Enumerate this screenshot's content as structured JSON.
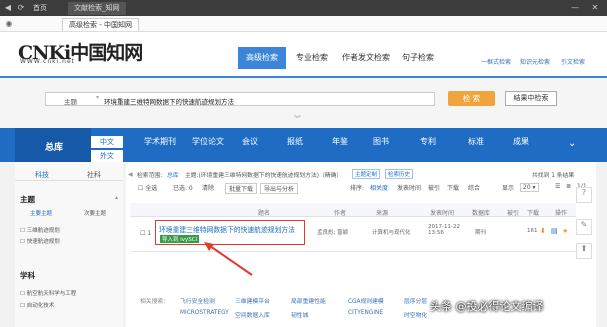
{
  "browser": {
    "tabs": [
      "首页",
      "文献检索_知网"
    ],
    "address_tab": "高级检索 - 中国知网"
  },
  "logo": {
    "text": "CNKi中国知网",
    "url": "WWW.cnki.net"
  },
  "nav": {
    "tabs": [
      "高级检索",
      "专业检索",
      "作者发文检索",
      "句子检索"
    ],
    "links": [
      "一框式检索",
      "知识元检索",
      "引文检索"
    ]
  },
  "search": {
    "field": "主题",
    "query": "环境重建三维特网数据下的快速航迹规划方法",
    "search_label": "检 索",
    "in_results_label": "结果中检索"
  },
  "db": {
    "total_label": "总库",
    "lang": [
      "中文",
      "外文"
    ],
    "categories": [
      "学术期刊",
      "学位论文",
      "会议",
      "报纸",
      "年鉴",
      "图书",
      "专利",
      "标准",
      "成果"
    ]
  },
  "left": {
    "sci_tabs": [
      "科技",
      "社科"
    ],
    "topic_title": "主题",
    "topic_tabs": [
      "主要主题",
      "次要主题"
    ],
    "topics": [
      "三维航迹规划",
      "快速航迹规划"
    ],
    "subject_title": "学科",
    "subjects": [
      "航空航天科学与工程",
      "自动化技术"
    ]
  },
  "toolbar": {
    "scope_label": "检索范围:",
    "scope_value": "总库",
    "query_echo": "主题:(环境重建三维特网数据下的快速航迹规划方法)（精确）",
    "theme_label": "主题定制",
    "history_label": "检索历史",
    "result_count": "共找到 1 条结果",
    "all_label": "全选",
    "selected": "已选: 0",
    "clear": "清除",
    "batch": "批量下载",
    "export": "导出与分析",
    "sort_label": "排序:",
    "sort_opts": [
      "相关度",
      "发表时间",
      "被引",
      "下载",
      "综合"
    ],
    "page_size": "显示",
    "pager": "1/1"
  },
  "table": {
    "headers": [
      "题名",
      "作者",
      "来源",
      "发表时间",
      "数据库",
      "被引",
      "下载",
      "操作"
    ],
    "rows": [
      {
        "num": "1",
        "title": "环境重建三维特网数据下的快速航迹规划方法",
        "author": "孟良彪; 曾颖",
        "source": "计算机与现代化",
        "date": "2017-11-22 13:56",
        "db": "期刊",
        "cite": "",
        "download": "161",
        "import": "导入到 ivySCI"
      }
    ]
  },
  "related": {
    "label": "相关搜索:",
    "items": [
      "飞行安全检测",
      "三维建模平台",
      "局部重建性能",
      "CGA规则建模",
      "层序分层",
      "MICROSTRATEGY",
      "空间数据入库",
      "韧性城",
      "CITYENGINE",
      "时空物化"
    ]
  },
  "watermark": "头条 @投必得论文编译",
  "colors": {
    "accent": "#1e6cc4",
    "highlight": "#e03a2e",
    "button": "#f0a43c"
  }
}
